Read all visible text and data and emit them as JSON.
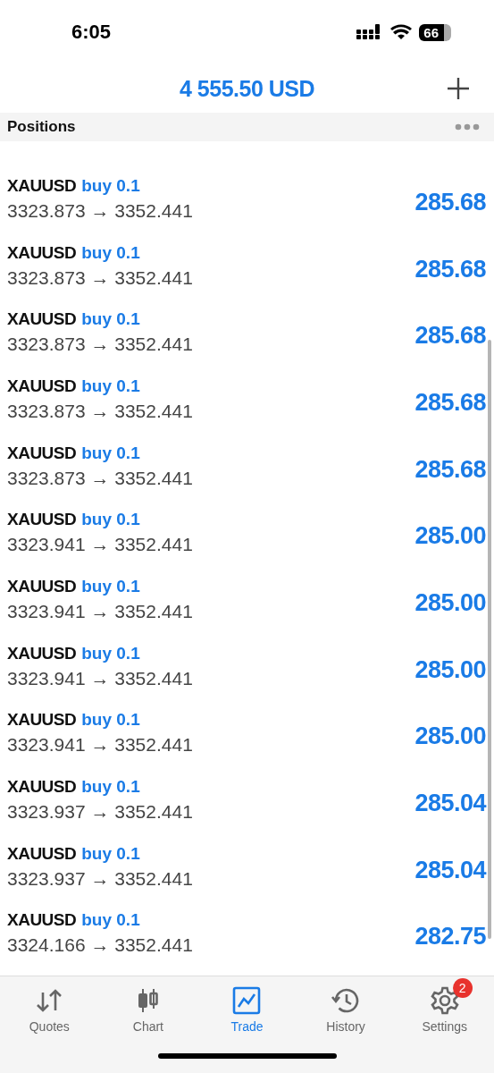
{
  "status_bar": {
    "time": "6:05",
    "battery": "66"
  },
  "header": {
    "balance": "4 555.50 USD"
  },
  "section": {
    "title": "Positions"
  },
  "positions": [
    {
      "symbol": "XAUUSD",
      "order": "buy 0.1",
      "prices": "3323.873 → 3352.441",
      "profit": "285.68"
    },
    {
      "symbol": "XAUUSD",
      "order": "buy 0.1",
      "prices": "3323.873 → 3352.441",
      "profit": "285.68"
    },
    {
      "symbol": "XAUUSD",
      "order": "buy 0.1",
      "prices": "3323.873 → 3352.441",
      "profit": "285.68"
    },
    {
      "symbol": "XAUUSD",
      "order": "buy 0.1",
      "prices": "3323.873 → 3352.441",
      "profit": "285.68"
    },
    {
      "symbol": "XAUUSD",
      "order": "buy 0.1",
      "prices": "3323.873 → 3352.441",
      "profit": "285.68"
    },
    {
      "symbol": "XAUUSD",
      "order": "buy 0.1",
      "prices": "3323.941 → 3352.441",
      "profit": "285.00"
    },
    {
      "symbol": "XAUUSD",
      "order": "buy 0.1",
      "prices": "3323.941 → 3352.441",
      "profit": "285.00"
    },
    {
      "symbol": "XAUUSD",
      "order": "buy 0.1",
      "prices": "3323.941 → 3352.441",
      "profit": "285.00"
    },
    {
      "symbol": "XAUUSD",
      "order": "buy 0.1",
      "prices": "3323.941 → 3352.441",
      "profit": "285.00"
    },
    {
      "symbol": "XAUUSD",
      "order": "buy 0.1",
      "prices": "3323.937 → 3352.441",
      "profit": "285.04"
    },
    {
      "symbol": "XAUUSD",
      "order": "buy 0.1",
      "prices": "3323.937 → 3352.441",
      "profit": "285.04"
    },
    {
      "symbol": "XAUUSD",
      "order": "buy 0.1",
      "prices": "3324.166 → 3352.441",
      "profit": "282.75"
    }
  ],
  "tabs": [
    {
      "label": "Quotes",
      "kind": "quotes",
      "selected": false
    },
    {
      "label": "Chart",
      "kind": "chart",
      "selected": false
    },
    {
      "label": "Trade",
      "kind": "trade",
      "selected": true
    },
    {
      "label": "History",
      "kind": "history",
      "selected": false
    },
    {
      "label": "Settings",
      "kind": "settings",
      "selected": false,
      "badge": "2"
    }
  ]
}
